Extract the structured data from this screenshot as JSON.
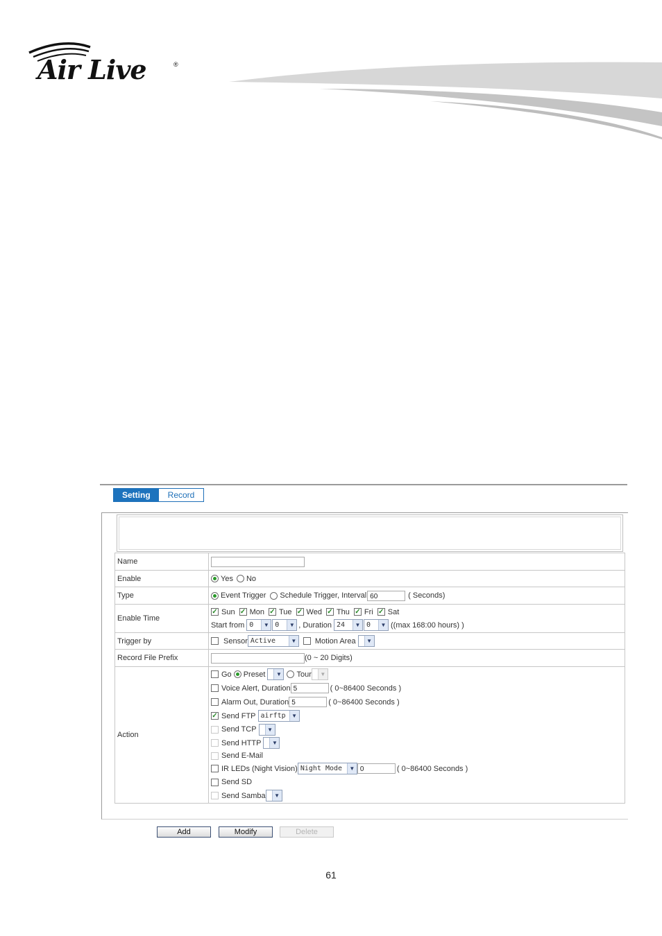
{
  "brand": {
    "logo_text": "Air Live",
    "reg_mark": "®"
  },
  "tabs": [
    {
      "label": "Setting",
      "active": true
    },
    {
      "label": "Record",
      "active": false
    }
  ],
  "form": {
    "name": {
      "label": "Name",
      "value": ""
    },
    "enable": {
      "label": "Enable",
      "options": [
        "Yes",
        "No"
      ],
      "selected": "Yes"
    },
    "type": {
      "label": "Type",
      "event_trigger": "Event Trigger",
      "schedule_trigger": "Schedule Trigger, Interval",
      "interval": "60",
      "unit": "( Seconds)",
      "selected": "Event Trigger"
    },
    "enable_time": {
      "label": "Enable Time",
      "days": [
        {
          "label": "Sun",
          "checked": true
        },
        {
          "label": "Mon",
          "checked": true
        },
        {
          "label": "Tue",
          "checked": true
        },
        {
          "label": "Wed",
          "checked": true
        },
        {
          "label": "Thu",
          "checked": true
        },
        {
          "label": "Fri",
          "checked": true
        },
        {
          "label": "Sat",
          "checked": true
        }
      ],
      "start_from_label": "Start from",
      "start_hour": "0",
      "start_min": "0",
      "duration_label": ", Duration",
      "duration_hour": "24",
      "duration_min": "0",
      "max_note": "((max 168:00 hours) )"
    },
    "trigger_by": {
      "label": "Trigger by",
      "sensor_label": "Sensor",
      "sensor_value": "Active",
      "motion_label": "Motion Area",
      "motion_value": ""
    },
    "record_prefix": {
      "label": "Record File Prefix",
      "value": "",
      "note": "(0 ~ 20 Digits)"
    },
    "action": {
      "label": "Action",
      "go_label": "Go",
      "preset_label": "Preset",
      "tour_label": "Tour",
      "voice_label": "Voice Alert, Duration",
      "voice_value": "5",
      "voice_note": "( 0~86400 Seconds )",
      "alarm_label": "Alarm Out, Duration",
      "alarm_value": "5",
      "alarm_note": "( 0~86400 Seconds )",
      "ftp_label": "Send FTP",
      "ftp_value": "airftp",
      "tcp_label": "Send TCP",
      "http_label": "Send HTTP",
      "email_label": "Send E-Mail",
      "ir_label": "IR LEDs (Night Vision)",
      "ir_mode": "Night Mode",
      "ir_value": "0",
      "ir_note": "( 0~86400 Seconds )",
      "sd_label": "Send SD",
      "samba_label": "Send Samba"
    }
  },
  "buttons": {
    "add": "Add",
    "modify": "Modify",
    "delete": "Delete"
  },
  "page_number": "61"
}
